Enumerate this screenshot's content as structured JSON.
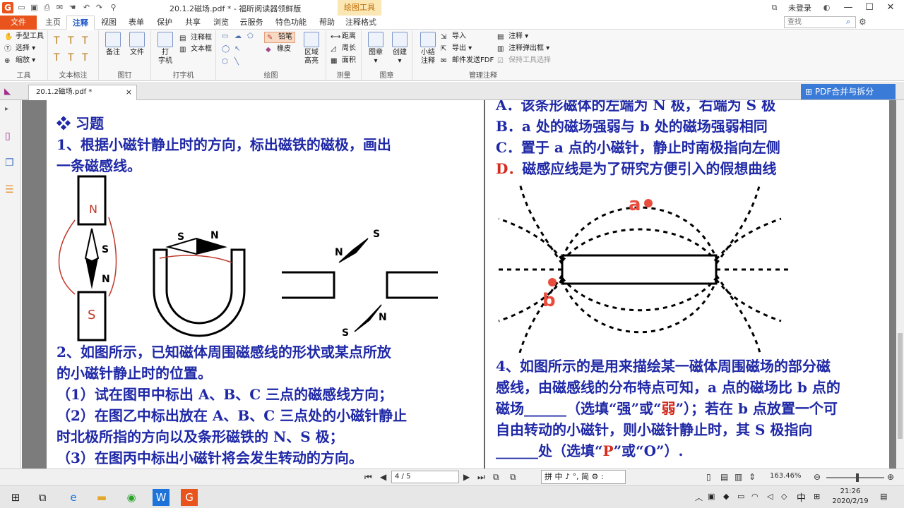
{
  "titlebar": {
    "doc_title": "20.1.2磁场.pdf * - 福昕阅读器领鲜版",
    "context_tab": "绘图工具",
    "login": "未登录",
    "min": "—",
    "max": "☐",
    "close": "✕"
  },
  "menu": {
    "file": "文件",
    "tabs": [
      "主页",
      "注释",
      "视图",
      "表单",
      "保护",
      "共享",
      "浏览",
      "云服务",
      "特色功能",
      "帮助",
      "注释格式"
    ],
    "active_tab": "注释",
    "search_placeholder": "查找"
  },
  "ribbon": {
    "tools": {
      "hand": "手型工具",
      "select": "选择",
      "zoom": "缩放",
      "label": "工具"
    },
    "text_markup": {
      "label": "文本标注"
    },
    "pin": {
      "note": "备注",
      "file": "文件",
      "label": "图钉"
    },
    "typewriter": {
      "typewriter": "打\n字机",
      "callout": "注释框",
      "textbox": "文本框",
      "label": "打字机"
    },
    "drawing": {
      "pencil": "铅笔",
      "eraser": "橡皮",
      "area_highlight": "区域\n高亮",
      "label": "绘图"
    },
    "measure": {
      "distance": "距离",
      "perimeter": "周长",
      "area": "面积",
      "label": "测量"
    },
    "stamp": {
      "stamp": "图章",
      "create": "创建",
      "label": "图章"
    },
    "manage": {
      "summary": "小结\n注释",
      "import": "导入",
      "export": "导出",
      "email_fdf": "邮件发送FDF",
      "comment": "注释",
      "popup": "注释弹出框",
      "keep_tool": "保持工具选择",
      "label": "管理注释"
    }
  },
  "doctab": {
    "name": "20.1.2磁场.pdf *",
    "close": "×",
    "merge_btn": "PDF合并与拆分"
  },
  "left_col": {
    "heading": "❖  习题",
    "q1_line1": "1、根据小磁针静止时的方向，标出磁铁的磁极，画出",
    "q1_line2": "一条磁感线。",
    "q2_line1": "2、如图所示，已知磁体周围磁感线的形状或某点所放",
    "q2_line2": "的小磁针静止时的位置。",
    "q2_item1": "（1）试在图甲中标出 A、B、C 三点的磁感线方向；",
    "q2_item2a": "（2）在图乙中标出放在 A、B、C 三点处的小磁针静止",
    "q2_item2b": "时北极所指的方向以及条形磁铁的 N、S 极；",
    "q2_item3": "（3）在图丙中标出小磁针将会发生转动的方向。"
  },
  "figure_labels": {
    "n": "N",
    "s": "S",
    "a": "a",
    "b": "b"
  },
  "right_col": {
    "optA": "A．该条形磁体的左端为 N 极，右端为 S 极",
    "optB": "B．a 处的磁场强弱与 b 处的磁场强弱相同",
    "optC": "C．置于 a 点的小磁针，静止时南极指向左侧",
    "optD_letter": "D．",
    "optD_text": "磁感应线是为了研究方便引入的假想曲线",
    "q4_line1": "4、如图所示的是用来描绘某一磁体周围磁场的部分磁",
    "q4_line2": "感线，由磁感线的分布特点可知，a 点的磁场比 b 点的",
    "q4_line3a": "磁场______（选填“强”或“",
    "q4_line3_weak": "弱",
    "q4_line3b": "”）；若在 b 点放置一个可",
    "q4_line4": "自由转动的小磁针，则小磁针静止时，其 S 极指向",
    "q4_line5a": "______处（选填“",
    "q4_line5_P": "P",
    "q4_line5b": "”或“O”）."
  },
  "statusbar": {
    "page": "4 / 5",
    "ime": "拼 中 ♪ °, 简 ⚙ :",
    "zoom": "163.46%"
  },
  "taskbar": {
    "time": "21:26",
    "date": "2020/2/19",
    "ime": "中"
  }
}
